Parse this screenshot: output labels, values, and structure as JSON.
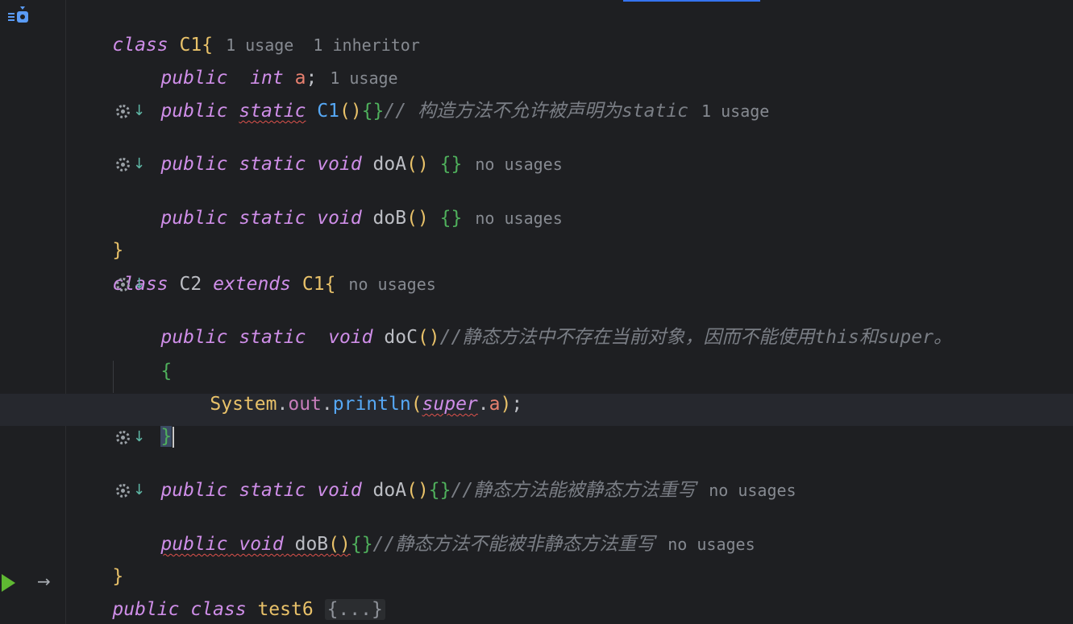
{
  "editor": {
    "line1": {
      "kw": "class",
      "name": "C1",
      "brace": "{",
      "hint": "1 usage  1 inheritor"
    },
    "line2": {
      "kw1": "public",
      "kw2": "int",
      "field": "a",
      "semi": ";",
      "hint": "1 usage"
    },
    "line3": {
      "kw1": "public",
      "kw2": "static",
      "ctor": "C1",
      "paren": "()",
      "braces": "{}",
      "comment": "// 构造方法不允许被声明为static",
      "hint": "1 usage"
    },
    "line4": {
      "kw1": "public",
      "kw2": "static",
      "kw3": "void",
      "name": "doA",
      "paren": "()",
      "braces": "{}",
      "hint": "no usages"
    },
    "line5": {
      "kw1": "public",
      "kw2": "static",
      "kw3": "void",
      "name": "doB",
      "paren": "()",
      "braces": "{}",
      "hint": "no usages"
    },
    "line6": {
      "brace": "}"
    },
    "line7": {
      "kw1": "class",
      "name": "C2",
      "kw2": "extends",
      "parent": "C1",
      "brace": "{",
      "hint": "no usages"
    },
    "line8": {
      "kw1": "public",
      "kw2": "static",
      "kw3": "void",
      "name": "doC",
      "paren": "()",
      "comment": "//静态方法中不存在当前对象，因而不能使用this和super。"
    },
    "line9": {
      "brace": "{"
    },
    "line10": {
      "cls": "System",
      "dot1": ".",
      "field": "out",
      "dot2": ".",
      "method": "println",
      "lparen": "(",
      "kw": "super",
      "dot3": ".",
      "field2": "a",
      "rparen": ")",
      "semi": ";"
    },
    "line11": {
      "brace": "}"
    },
    "line12": {
      "kw1": "public",
      "kw2": "static",
      "kw3": "void",
      "name": "doA",
      "paren": "()",
      "braces": "{}",
      "comment": "//静态方法能被静态方法重写",
      "hint": "no usages"
    },
    "line13": {
      "kw1": "public",
      "kw2": "void",
      "name": "doB",
      "paren": "()",
      "braces": "{}",
      "comment": "//静态方法不能被非静态方法重写",
      "hint": "no usages"
    },
    "line14": {
      "brace": "}"
    },
    "line15": {
      "kw1": "public",
      "kw2": "class",
      "name": "test6",
      "folded": "{...}"
    }
  },
  "icons": {
    "class_icon": "class-with-inheritor-icon",
    "override": "overridden-method-icon",
    "run": "run-icon",
    "nav": "navigate-arrow-icon"
  },
  "colors": {
    "background": "#1e1f22",
    "keyword": "#cf8ee8",
    "class_name": "#e8c169",
    "comment": "#7a7e85",
    "hint": "#868a91",
    "method_call": "#56a8f5",
    "brace_green": "#4fb05c",
    "error_underline": "#e0524c"
  }
}
